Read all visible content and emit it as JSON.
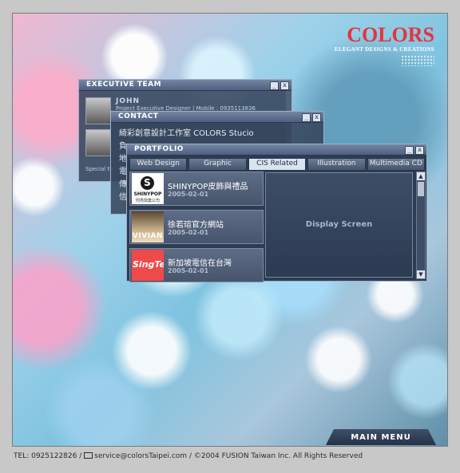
{
  "logo": {
    "name": "COLORS",
    "tagline": "ELEGANT DESIGNS & CREATIONS"
  },
  "executive_window": {
    "title": "EXECUTIVE TEAM",
    "members": [
      {
        "name": "JOHN",
        "title": "Project Executive Designer | Mobile : 0935113836"
      },
      {
        "name": "",
        "title": "Special th"
      }
    ]
  },
  "contact_window": {
    "title": "CONTACT",
    "company": "綺彩創意設計工作室 COLORS Stucio",
    "lines": [
      "負",
      "地",
      "電",
      "傳",
      "信"
    ]
  },
  "portfolio_window": {
    "title": "PORTFOLIO",
    "tabs": [
      "Web Design",
      "Graphic",
      "CIS Related",
      "Illustration",
      "Multimedia CD"
    ],
    "active_tab": "CIS Related",
    "items": [
      {
        "title": "SHINYPOP皮飾與禮品",
        "date": "2005-02-01",
        "thumb_label": "SHINYPOP",
        "thumb_sub": "閃亮興業公司",
        "thumb_mark": "S"
      },
      {
        "title": "徐若瑄官方網站",
        "date": "2005-02-01",
        "thumb_label": "VIVIAN"
      },
      {
        "title": "新加坡電信在台灣",
        "date": "2005-02-01",
        "thumb_label": "SingTel"
      }
    ],
    "display_text": "Display Screen"
  },
  "controls": {
    "minimize": "_",
    "close": "x",
    "scroll_up": "▲",
    "scroll_down": "▼"
  },
  "main_menu": "MAIN MENU",
  "footer": {
    "tel": "TEL: 0925122826  /",
    "email": "service@colorsTaipei.com",
    "copyright": "/  ©2004 FUSION Taiwan Inc. All Rights Reserved"
  },
  "colors": {
    "brand_red": "#e8323c",
    "window_bg": "#36465c",
    "active_tab": "#d9e4f0"
  }
}
